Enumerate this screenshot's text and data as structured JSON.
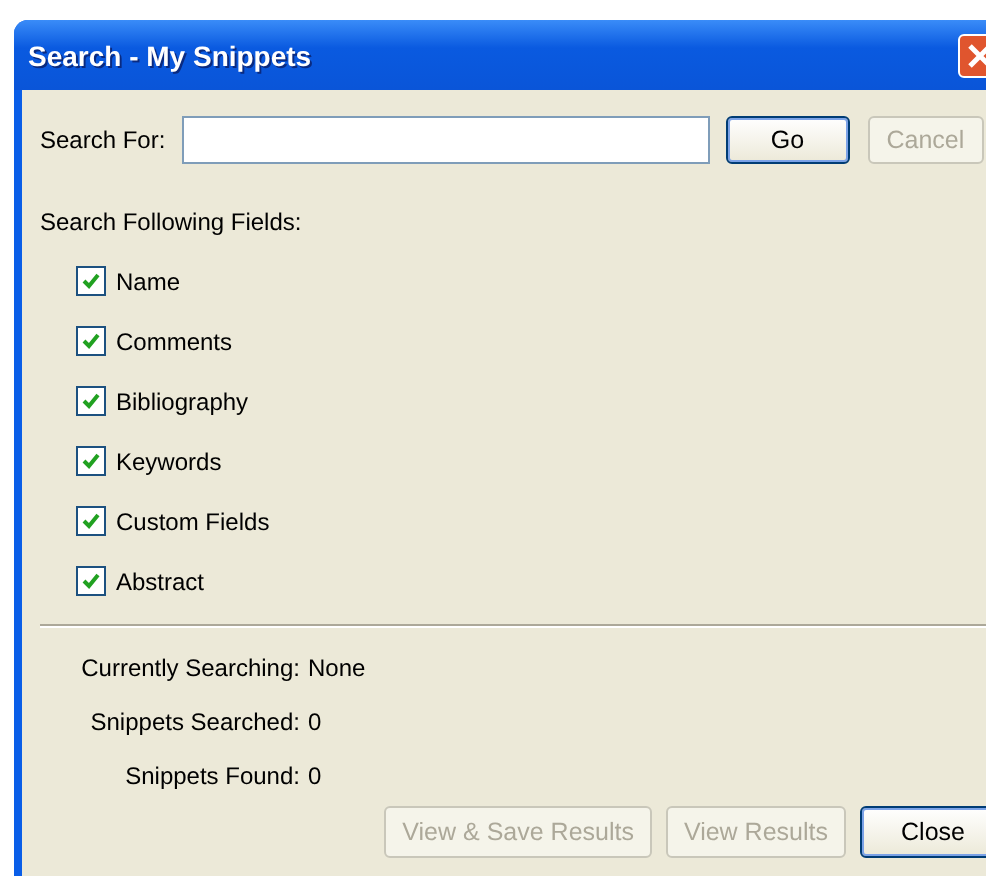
{
  "window": {
    "title": "Search - My Snippets"
  },
  "search": {
    "label": "Search For:",
    "buttons": [
      {
        "label": "Go",
        "disabled": false
      },
      {
        "label": "Cancel",
        "disabled": true
      }
    ]
  },
  "fields_heading": "Search Following Fields:",
  "fields": [
    {
      "label": "Name",
      "checked": true
    },
    {
      "label": "Comments",
      "checked": true
    },
    {
      "label": "Bibliography",
      "checked": true
    },
    {
      "label": "Keywords",
      "checked": true
    },
    {
      "label": "Custom Fields",
      "checked": true
    },
    {
      "label": "Abstract",
      "checked": true
    }
  ],
  "status": [
    {
      "label": "Currently Searching:",
      "value": "None"
    },
    {
      "label": "Snippets Searched:",
      "value": "0"
    },
    {
      "label": "Snippets Found:",
      "value": "0"
    }
  ],
  "buttons": [
    {
      "label": "View & Save Results",
      "disabled": true
    },
    {
      "label": "View Results",
      "disabled": true
    },
    {
      "label": "Close",
      "disabled": false
    }
  ]
}
